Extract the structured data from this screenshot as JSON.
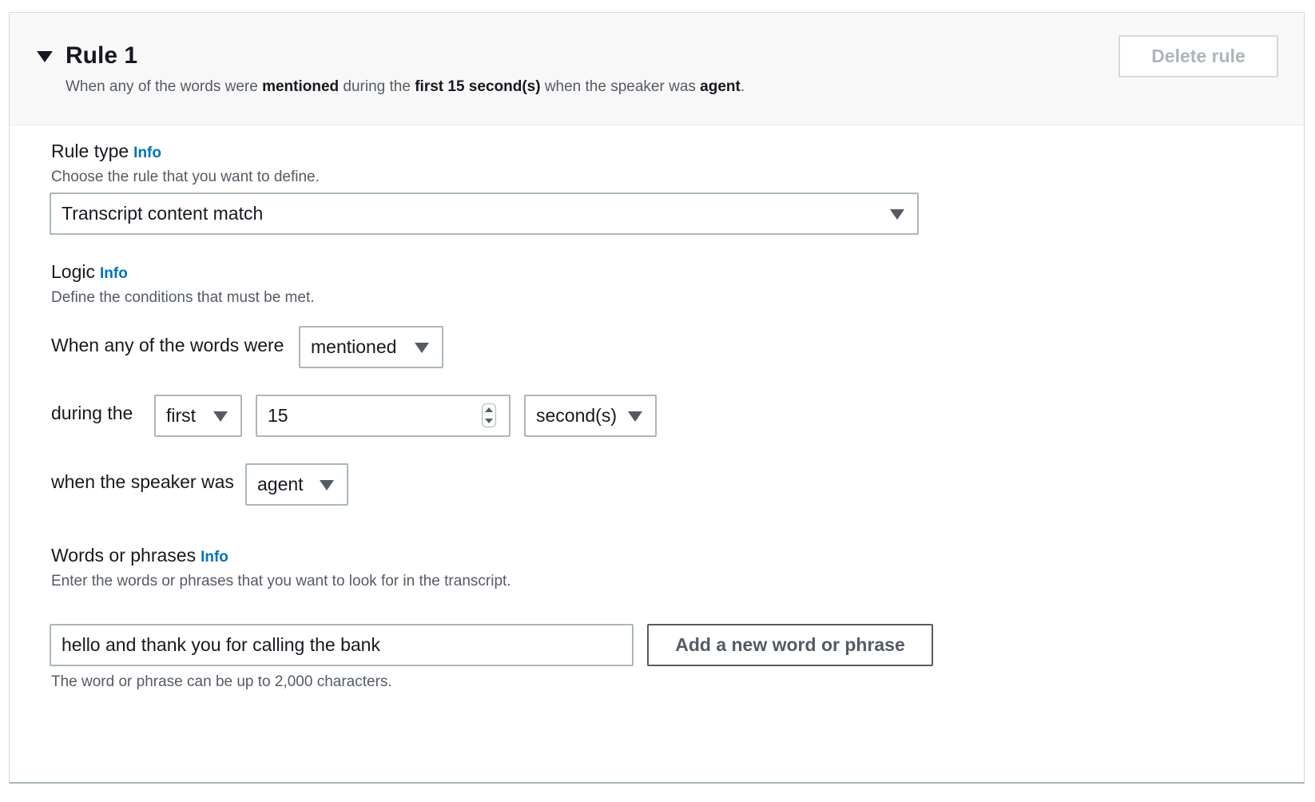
{
  "rule": {
    "title": "Rule 1",
    "summary": {
      "p1": "When any of the words were ",
      "b1": "mentioned",
      "p2": " during the ",
      "b2": "first 15 second(s)",
      "p3": " when the speaker was ",
      "b3": "agent",
      "p4": "."
    },
    "delete_label": "Delete rule"
  },
  "rule_type": {
    "label": "Rule type",
    "info": "Info",
    "description": "Choose the rule that you want to define.",
    "selected": "Transcript content match"
  },
  "logic": {
    "label": "Logic",
    "info": "Info",
    "description": "Define the conditions that must be met.",
    "words_prefix": "When any of the words were",
    "mention_selected": "mentioned",
    "during_prefix": "during the",
    "position_selected": "first",
    "duration_value": "15",
    "unit_selected": "second(s)",
    "speaker_prefix": "when the speaker was",
    "speaker_selected": "agent"
  },
  "words": {
    "label": "Words or phrases",
    "info": "Info",
    "description": "Enter the words or phrases that you want to look for in the transcript.",
    "input_value": "hello and thank you for calling the bank",
    "add_label": "Add a new word or phrase",
    "hint": "The word or phrase can be up to 2,000 characters."
  },
  "icons": {
    "collapse": "caret-down-icon",
    "dropdown": "triangle-down-icon",
    "spinner": "number-spinner-icon"
  },
  "colors": {
    "link": "#0073bb",
    "text": "#16191f",
    "secondary_text": "#545b64",
    "border": "#aab7b8",
    "disabled": "#aab7b8",
    "header_bg": "#f8f8f8"
  }
}
